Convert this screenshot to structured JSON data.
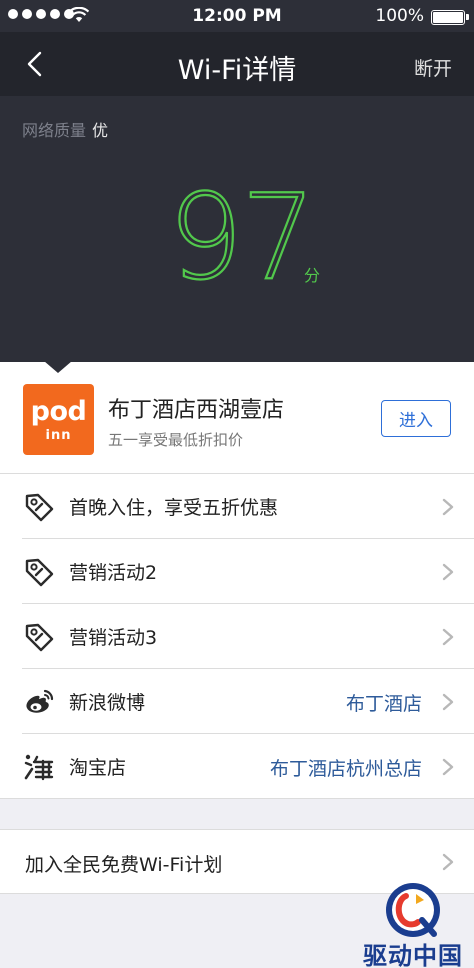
{
  "status_bar": {
    "time": "12:00 PM",
    "battery": "100%",
    "signal_icon": "signal-dots-icon",
    "wifi_icon": "wifi-icon"
  },
  "nav": {
    "title": "Wi-Fi详情",
    "right_action": "断开",
    "back_icon": "chevron-left-icon"
  },
  "quality": {
    "label": "网络质量",
    "value": "优",
    "score": "97",
    "unit": "分",
    "score_color": "#52c84c"
  },
  "store": {
    "logo_text_top": "pod",
    "logo_text_bottom": "inn",
    "logo_color": "#f2691e",
    "name": "布丁酒店西湖壹店",
    "promo": "五一享受最低折扣价",
    "enter_label": "进入"
  },
  "rows": [
    {
      "icon": "tag-icon",
      "label": "首晚入住，享受五折优惠",
      "value": ""
    },
    {
      "icon": "tag-icon",
      "label": "营销活动2",
      "value": ""
    },
    {
      "icon": "tag-icon",
      "label": "营销活动3",
      "value": ""
    },
    {
      "icon": "weibo-icon",
      "label": "新浪微博",
      "value": "布丁酒店"
    },
    {
      "icon": "taobao-icon",
      "label": "淘宝店",
      "value": "布丁酒店杭州总店"
    }
  ],
  "join": {
    "label": "加入全民免费Wi-Fi计划"
  },
  "watermark": {
    "text": "驱动中国"
  },
  "colors": {
    "dark_bg": "#2d2f38",
    "nav_bg": "#23252c",
    "link_blue": "#2e6fd8",
    "value_blue": "#2e5b9a"
  }
}
